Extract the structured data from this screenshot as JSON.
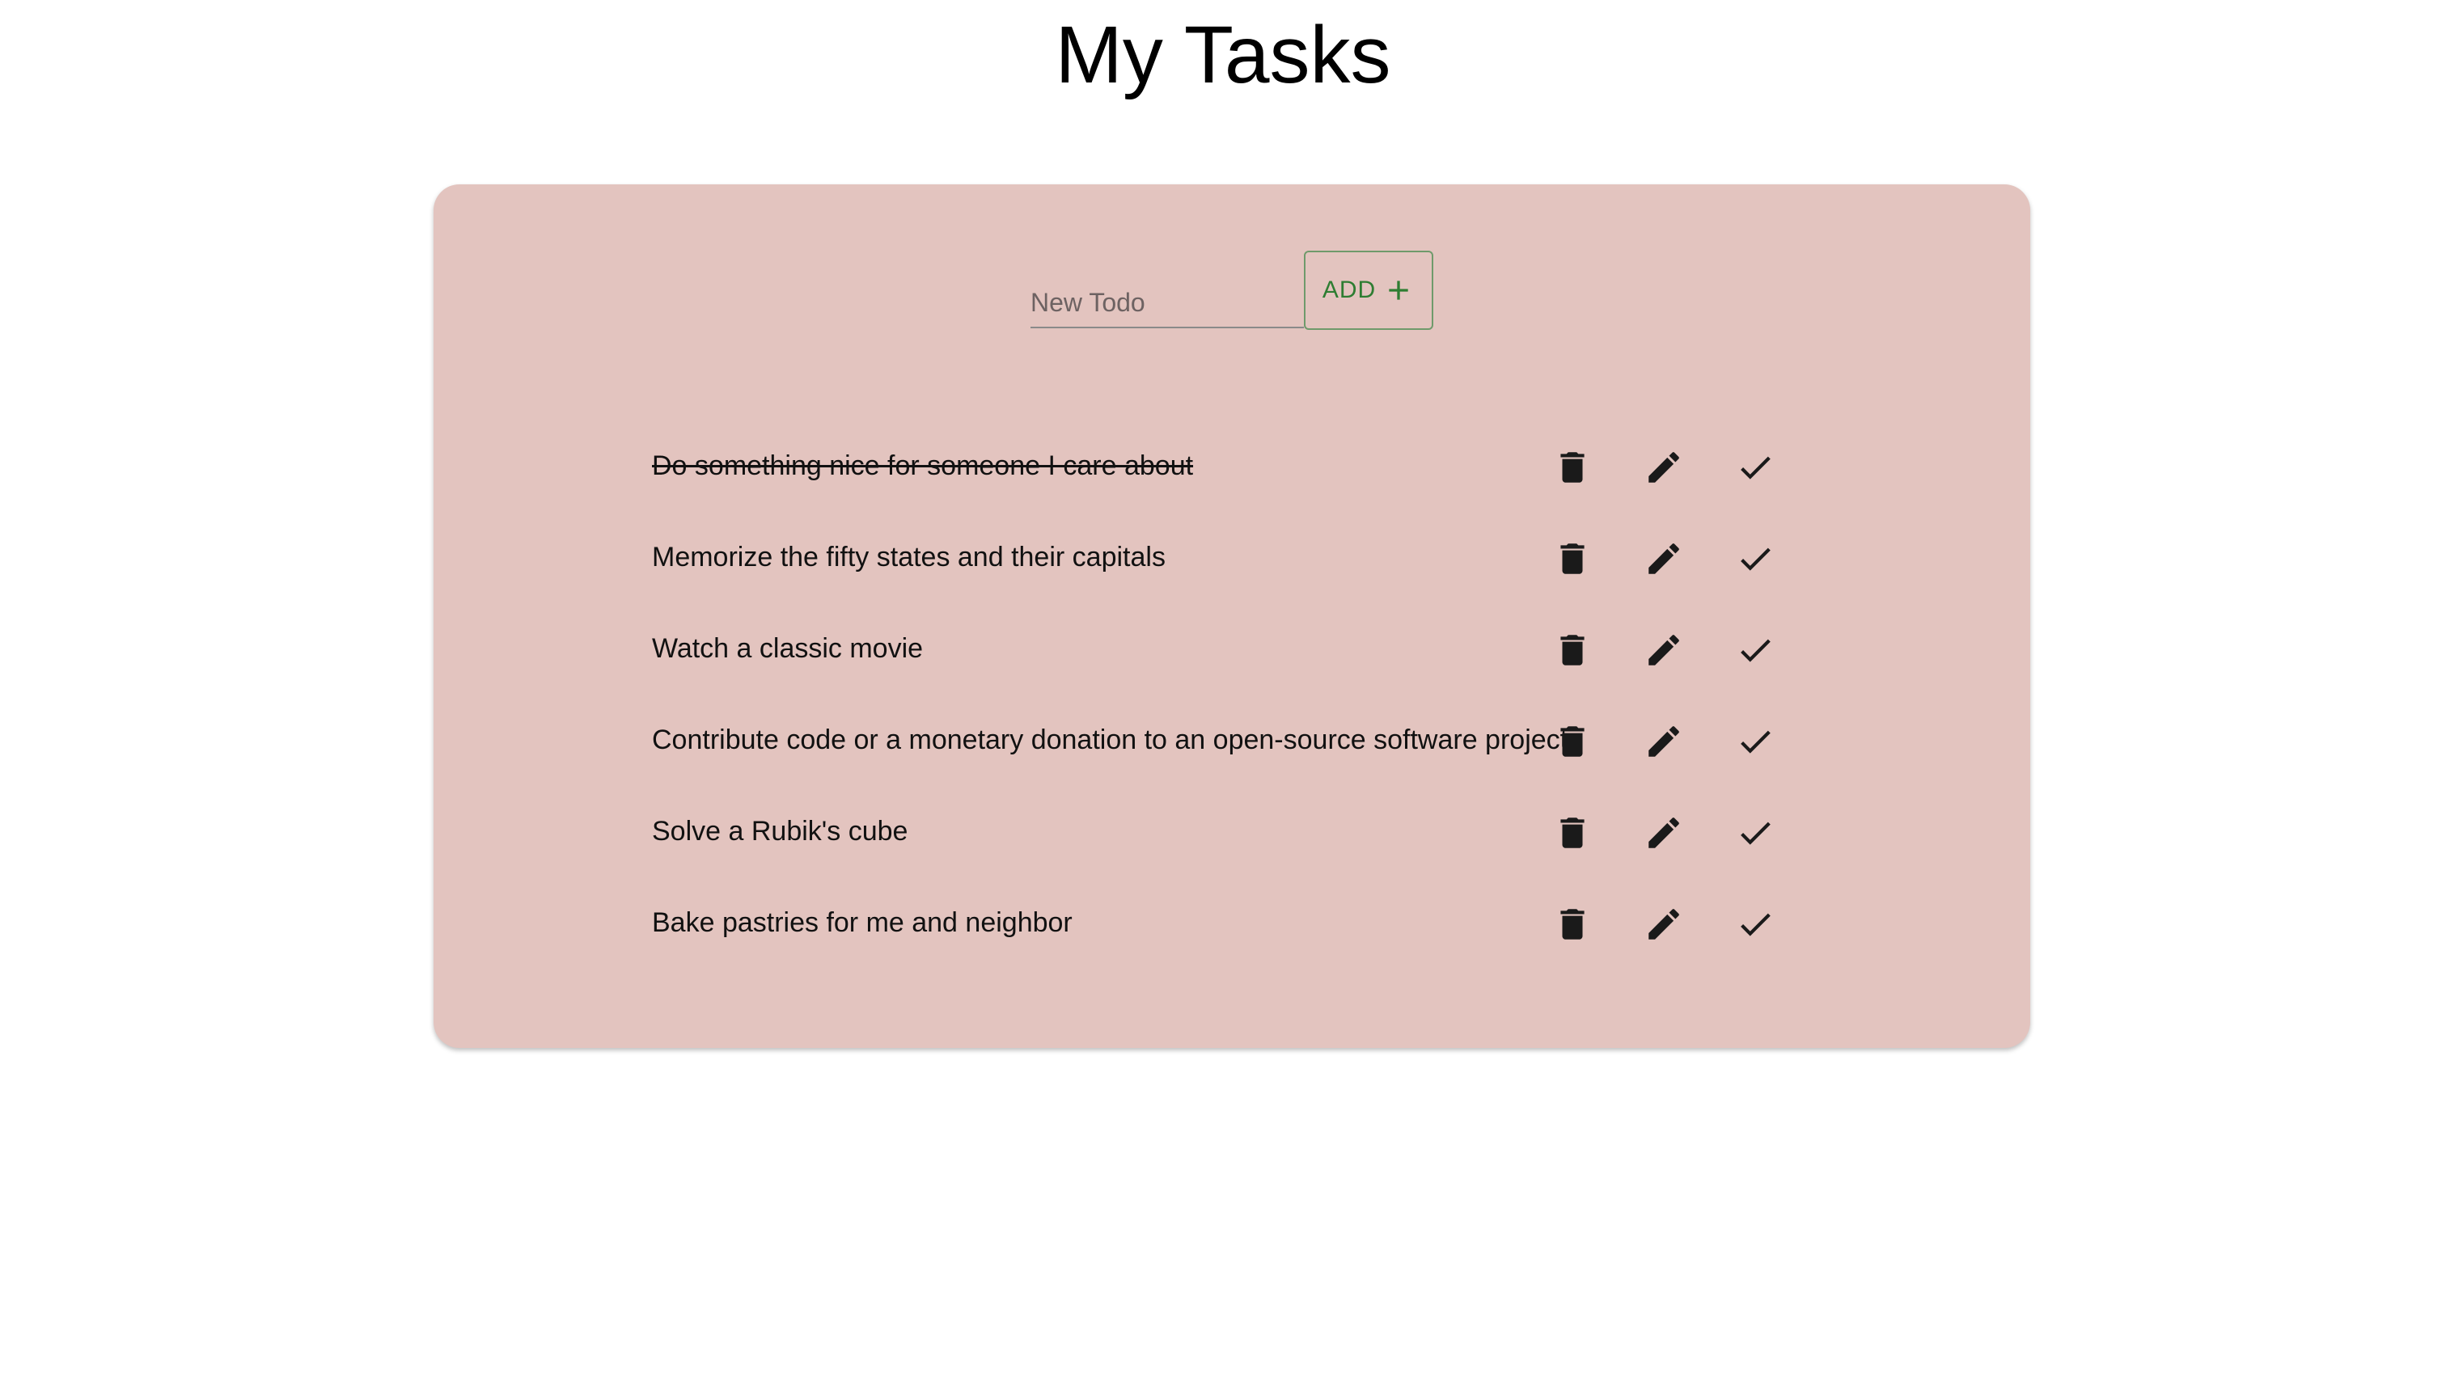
{
  "header": {
    "title": "My Tasks"
  },
  "colors": {
    "card_background": "#e3c4bf",
    "accent_green": "#2e7d32",
    "icon_color": "#1a1a1a"
  },
  "add_form": {
    "input_placeholder": "New Todo",
    "input_value": "",
    "add_label": "ADD",
    "add_icon": "plus-icon"
  },
  "todos": [
    {
      "text": "Do something nice for someone I care about",
      "completed": true
    },
    {
      "text": "Memorize the fifty states and their capitals",
      "completed": false
    },
    {
      "text": "Watch a classic movie",
      "completed": false
    },
    {
      "text": "Contribute code or a monetary donation to an open-source software project",
      "completed": false
    },
    {
      "text": "Solve a Rubik's cube",
      "completed": false
    },
    {
      "text": "Bake pastries for me and neighbor",
      "completed": false
    }
  ],
  "item_actions": [
    "trash-icon",
    "pencil-icon",
    "checkmark-icon"
  ]
}
